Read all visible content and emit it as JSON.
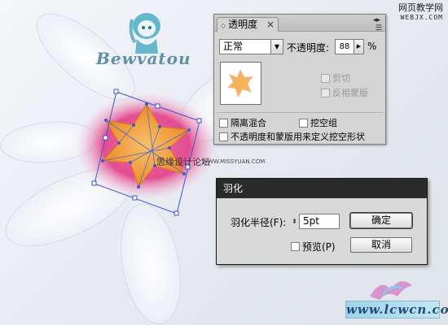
{
  "site": {
    "top_right_line1": "网页教学网",
    "top_right_line2": "WEBJX.COM",
    "bottom_right_logo": "www.lcwcn.com"
  },
  "artwork": {
    "logo_text": "Bewvatou",
    "watermark_cn": "思缘设计论坛",
    "watermark_en": "WWW.MISSYUAN.COM"
  },
  "transparency_panel": {
    "tab_label": "透明度",
    "tab_close": "×",
    "collapse_glyph": "◂▸",
    "menu_glyph": "☰",
    "blend_mode": "正常",
    "opacity_label": "不透明度:",
    "opacity_value": "88",
    "opacity_unit": "%",
    "clip_label": "剪切",
    "invert_mask_label": "反相蒙版",
    "isolate_label": "隔离混合",
    "knockout_label": "挖空组",
    "define_knockout_label": "不透明度和蒙版用来定义挖空形状"
  },
  "feather_dialog": {
    "title": "羽化",
    "radius_label": "羽化半径(F):",
    "radius_value": "5pt",
    "preview_label": "预览(P)",
    "ok_label": "确定",
    "cancel_label": "取消"
  },
  "colors": {
    "dialog_titlebar": "#2a2a2a",
    "panel_bg": "#d4d4d4",
    "flower_orange": "#f0a23a",
    "flower_pink": "#e0307f",
    "selection_blue": "#3d55c9"
  }
}
